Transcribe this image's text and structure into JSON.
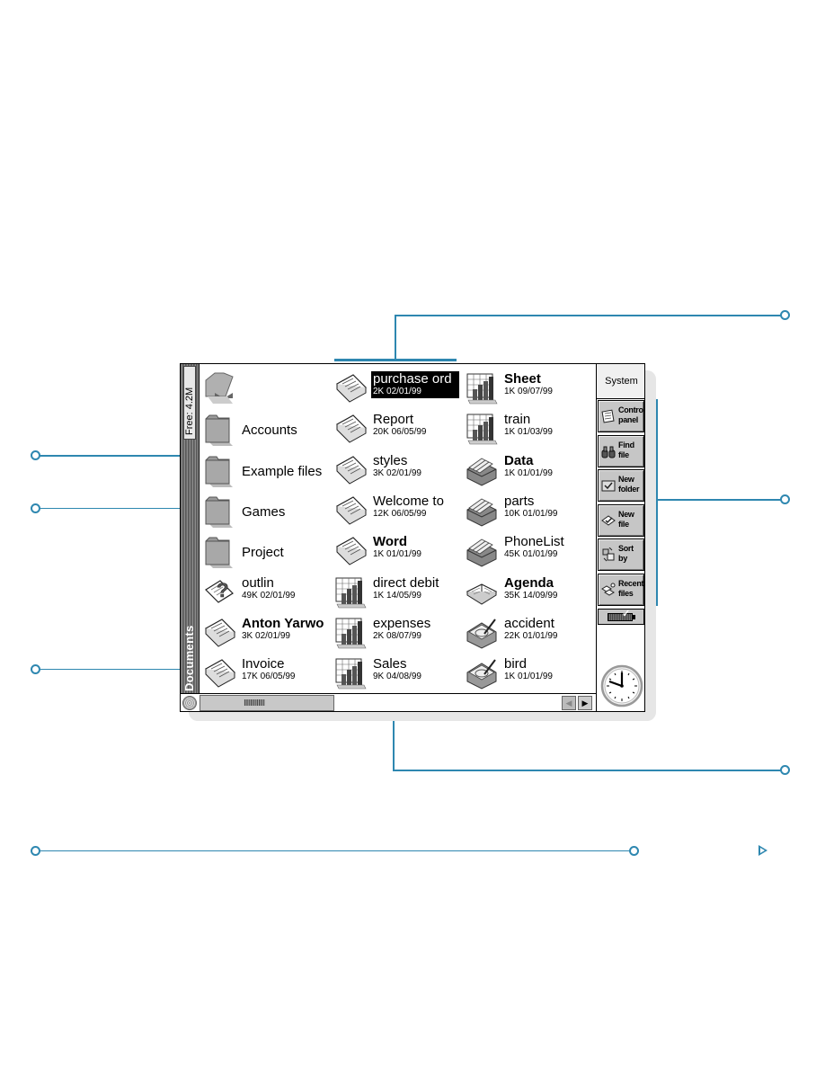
{
  "window": {
    "free_space": "Free: 4.2M",
    "folder_label": "Documents"
  },
  "items": [
    {
      "name": "",
      "meta": "",
      "icon": "parent-folder-icon",
      "kind": "up"
    },
    {
      "name": "Accounts",
      "meta": "",
      "icon": "folder-icon",
      "kind": "folder"
    },
    {
      "name": "Example files",
      "meta": "",
      "icon": "folder-icon",
      "kind": "folder"
    },
    {
      "name": "Games",
      "meta": "",
      "icon": "folder-icon",
      "kind": "folder"
    },
    {
      "name": "Project",
      "meta": "",
      "icon": "folder-icon",
      "kind": "folder"
    },
    {
      "name": "outlin",
      "meta": "49K 02/01/99",
      "icon": "unknown-file-icon",
      "kind": "unknown"
    },
    {
      "name": "Anton Yarwo",
      "meta": "3K 02/01/99",
      "icon": "word-document-icon",
      "kind": "doc",
      "bold": true
    },
    {
      "name": "Invoice",
      "meta": "17K 06/05/99",
      "icon": "word-document-icon",
      "kind": "doc"
    },
    {
      "name": "purchase ord",
      "meta": "2K 02/01/99",
      "icon": "word-document-icon",
      "kind": "doc",
      "selected": true
    },
    {
      "name": "Report",
      "meta": "20K 06/05/99",
      "icon": "word-document-icon",
      "kind": "doc"
    },
    {
      "name": "styles",
      "meta": "3K 02/01/99",
      "icon": "word-document-icon",
      "kind": "doc"
    },
    {
      "name": "Welcome to",
      "meta": "12K 06/05/99",
      "icon": "word-document-icon",
      "kind": "doc"
    },
    {
      "name": "Word",
      "meta": "1K 01/01/99",
      "icon": "word-document-icon",
      "kind": "doc",
      "bold": true
    },
    {
      "name": "direct debit",
      "meta": "1K 14/05/99",
      "icon": "spreadsheet-icon",
      "kind": "sheet"
    },
    {
      "name": "expenses",
      "meta": "2K 08/07/99",
      "icon": "spreadsheet-icon",
      "kind": "sheet"
    },
    {
      "name": "Sales",
      "meta": "9K 04/08/99",
      "icon": "spreadsheet-icon",
      "kind": "sheet"
    },
    {
      "name": "Sheet",
      "meta": "1K 09/07/99",
      "icon": "spreadsheet-icon",
      "kind": "sheet",
      "bold": true
    },
    {
      "name": "train",
      "meta": "1K 01/03/99",
      "icon": "spreadsheet-icon",
      "kind": "sheet"
    },
    {
      "name": "Data",
      "meta": "1K 01/01/99",
      "icon": "database-icon",
      "kind": "data",
      "bold": true
    },
    {
      "name": "parts",
      "meta": "10K 01/01/99",
      "icon": "database-icon",
      "kind": "data"
    },
    {
      "name": "PhoneList",
      "meta": "45K 01/01/99",
      "icon": "database-icon",
      "kind": "data"
    },
    {
      "name": "Agenda",
      "meta": "35K 14/09/99",
      "icon": "agenda-icon",
      "kind": "agenda",
      "bold": true
    },
    {
      "name": "accident",
      "meta": "22K 01/01/99",
      "icon": "sketch-icon",
      "kind": "sketch"
    },
    {
      "name": "bird",
      "meta": "1K 01/01/99",
      "icon": "sketch-icon",
      "kind": "sketch"
    }
  ],
  "toolbar": {
    "title": "System",
    "buttons": [
      {
        "label1": "Control",
        "label2": "panel",
        "icon": "control-panel-icon"
      },
      {
        "label1": "Find",
        "label2": "file",
        "icon": "binoculars-icon"
      },
      {
        "label1": "New",
        "label2": "folder",
        "icon": "new-folder-icon"
      },
      {
        "label1": "New",
        "label2": "file",
        "icon": "new-file-icon"
      },
      {
        "label1": "Sort",
        "label2": "by",
        "icon": "sort-icon"
      },
      {
        "label1": "Recent",
        "label2": "files",
        "icon": "recent-files-icon"
      }
    ]
  },
  "status": {
    "battery_ok": true,
    "clock_time": "10:51"
  },
  "scrollbar": {
    "thumb": "IIIIIIIIIIIII",
    "left_arrow": "◀",
    "right_arrow": "▶"
  },
  "colors": {
    "callout": "#2e87b0",
    "selection": "#000000"
  }
}
